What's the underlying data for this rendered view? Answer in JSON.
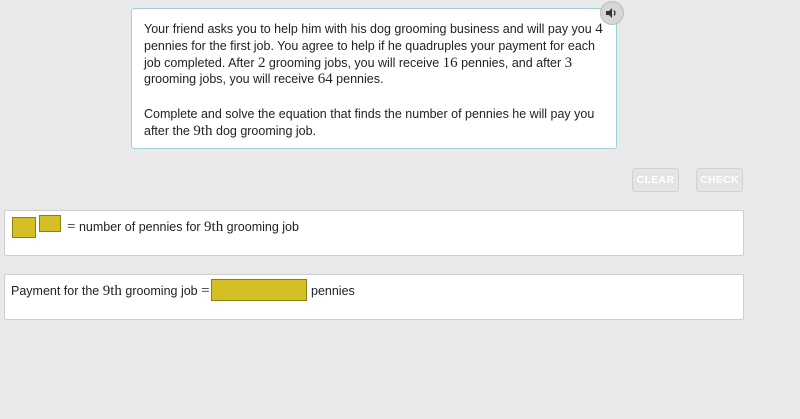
{
  "problem": {
    "p1_before": "Your friend asks you to help him with his dog grooming business and will pay you ",
    "p1_n1": "4",
    "p1_mid1": " pennies for the first job. You agree to help if he quadruples your payment for each job completed. After ",
    "p1_n2": "2",
    "p1_mid2": " grooming jobs, you will receive ",
    "p1_n3": "16",
    "p1_mid3": " pennies, and after ",
    "p1_n4": "3",
    "p1_mid4": " grooming jobs, you will receive ",
    "p1_n5": "64",
    "p1_end": " pennies.",
    "p2_before": "Complete and solve the equation that finds the number of pennies he will pay you after the ",
    "p2_n": "9th",
    "p2_end": " dog grooming job."
  },
  "controls": {
    "clear_label": "CLEAR",
    "check_label": "CHECK"
  },
  "equation": {
    "equals": "=",
    "label_before": "number of pennies for ",
    "label_ordinal": "9th",
    "label_after": " grooming job"
  },
  "answer": {
    "label_before": "Payment for the ",
    "label_ordinal": "9th",
    "label_after": " grooming job ",
    "equals": "=",
    "unit": "pennies"
  },
  "colors": {
    "slot_fill": "#d4bf26",
    "panel_border": "#9fd2dc"
  },
  "icons": {
    "audio": "speaker-icon"
  }
}
